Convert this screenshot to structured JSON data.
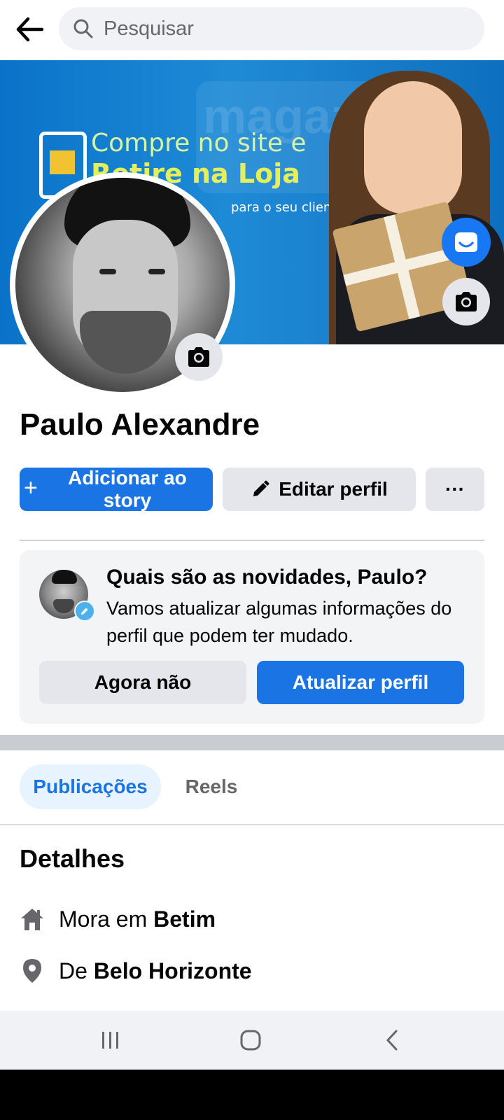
{
  "search": {
    "placeholder": "Pesquisar"
  },
  "cover": {
    "line1": "Compre no site e",
    "line2": "Retire na Loja",
    "line3": "para o seu cliente!",
    "bg_word": "magazi"
  },
  "profile": {
    "name": "Paulo Alexandre"
  },
  "actions": {
    "add_story_label": "Adicionar ao story",
    "edit_profile_label": "Editar perfil",
    "more_label": "···"
  },
  "update_card": {
    "title": "Quais são as novidades, Paulo?",
    "text": "Vamos atualizar algumas informações do perfil que podem ter mudado.",
    "not_now_label": "Agora não",
    "update_label": "Atualizar perfil"
  },
  "tabs": [
    {
      "label": "Publicações",
      "selected": true
    },
    {
      "label": "Reels",
      "selected": false
    }
  ],
  "details": {
    "title": "Detalhes",
    "items": [
      {
        "icon": "home-icon",
        "prefix": "Mora em ",
        "value": "Betim"
      },
      {
        "icon": "location-pin-icon",
        "prefix": "De ",
        "value": "Belo Horizonte"
      }
    ]
  },
  "colors": {
    "primary": "#1b74e4",
    "tab_selected_bg": "#e7f3ff",
    "secondary_button": "#e4e6eb",
    "text": "#050505",
    "muted": "#65676b"
  }
}
